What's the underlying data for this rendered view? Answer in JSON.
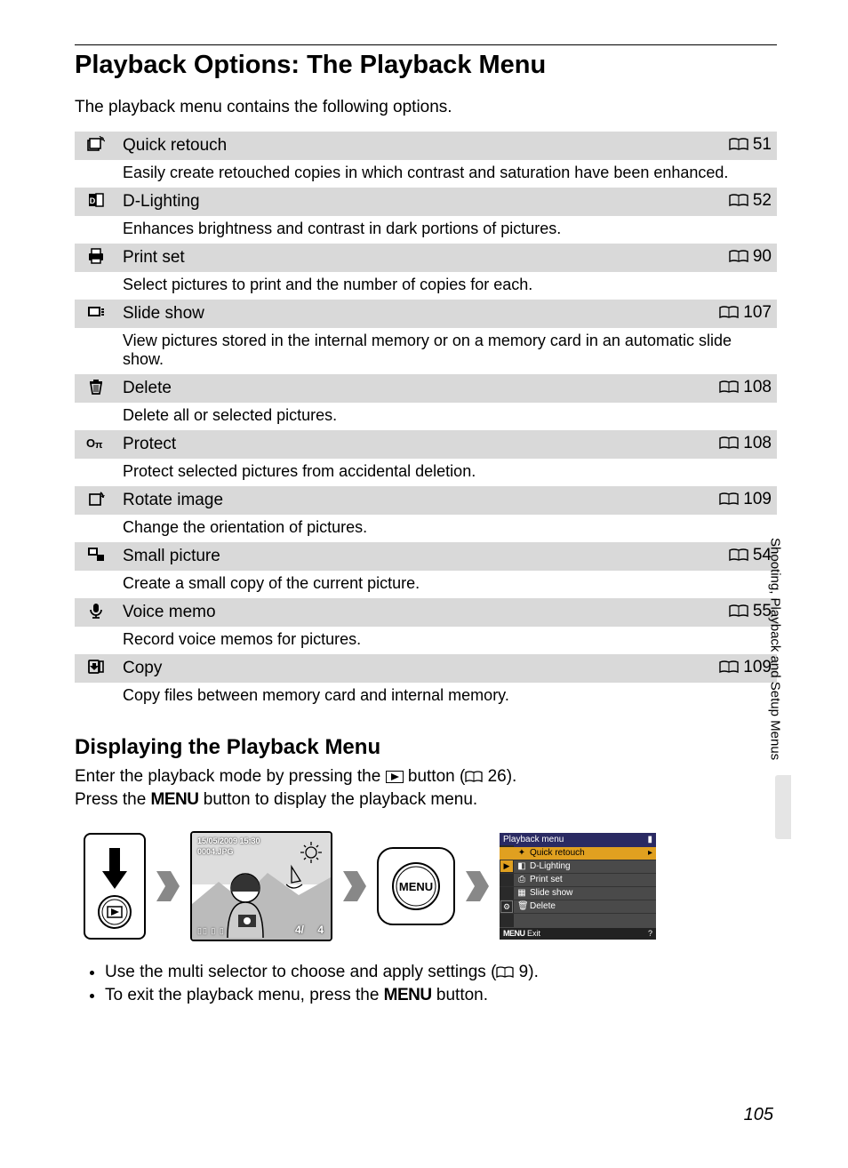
{
  "title": "Playback Options: The Playback Menu",
  "intro": "The playback menu contains the following options.",
  "items": [
    {
      "label": "Quick retouch",
      "page": "51",
      "desc": "Easily create retouched copies in which contrast and saturation have been enhanced."
    },
    {
      "label": "D-Lighting",
      "page": "52",
      "desc": "Enhances brightness and contrast in dark portions of pictures."
    },
    {
      "label": "Print set",
      "page": "90",
      "desc": "Select pictures to print and the number of copies for each."
    },
    {
      "label": "Slide show",
      "page": "107",
      "desc": "View pictures stored in the internal memory or on a memory card in an automatic slide show."
    },
    {
      "label": "Delete",
      "page": "108",
      "desc": "Delete all or selected pictures."
    },
    {
      "label": "Protect",
      "page": "108",
      "desc": "Protect selected pictures from accidental deletion."
    },
    {
      "label": "Rotate image",
      "page": "109",
      "desc": "Change the orientation of pictures."
    },
    {
      "label": "Small picture",
      "page": "54",
      "desc": "Create a small copy of the current picture."
    },
    {
      "label": "Voice memo",
      "page": "55",
      "desc": "Record voice memos for pictures."
    },
    {
      "label": "Copy",
      "page": "109",
      "desc": "Copy files between memory card and internal memory."
    }
  ],
  "subtitle": "Displaying the Playback Menu",
  "body1a": "Enter the playback mode by pressing the ",
  "body1b": " button (",
  "body1c": " 26).",
  "body2a": "Press the ",
  "body2b": " button to display the playback menu.",
  "menu_word": "MENU",
  "lcd": {
    "date": "15/05/2009 15:30",
    "file": "0004.JPG",
    "count_left": "4/",
    "count_right": "4"
  },
  "menu_screen": {
    "title": "Playback menu",
    "rows": [
      "Quick retouch",
      "D-Lighting",
      "Print set",
      "Slide show",
      "Delete"
    ],
    "foot_left": "Exit",
    "foot_menu": "MENU"
  },
  "bullet1a": "Use the multi selector to choose and apply settings (",
  "bullet1b": " 9).",
  "bullet2a": "To exit the playback menu, press the ",
  "bullet2b": " button.",
  "side_label": "Shooting, Playback and Setup Menus",
  "page_number": "105"
}
